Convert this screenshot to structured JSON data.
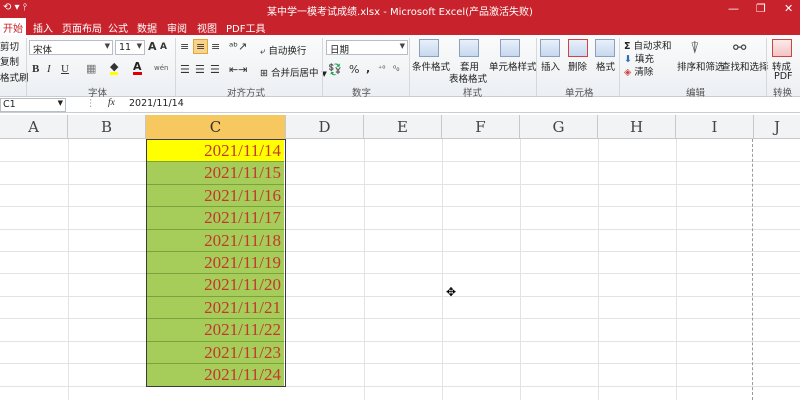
{
  "window": {
    "title": "某中学一模考试成绩.xlsx - Microsoft Excel(产品激活失败)",
    "quick_access": "⟲ ▾ ⫯",
    "controls": [
      "—",
      "❐",
      "✕"
    ]
  },
  "menu": {
    "tabs": [
      "开始",
      "插入",
      "页面布局",
      "公式",
      "数据",
      "审阅",
      "视图",
      "PDF工具"
    ],
    "active": "开始"
  },
  "ribbon": {
    "clipboard": {
      "cut": "剪切",
      "copy": "复制",
      "format_painter": "格式刷"
    },
    "font": {
      "name": "宋体",
      "size": "11",
      "grow": "A",
      "shrink": "A",
      "bold": "B",
      "italic": "I",
      "underline": "U",
      "font_color": "A",
      "wen": "wén",
      "group_label": "字体"
    },
    "alignment": {
      "wrap": "自动换行",
      "merge": "合并后居中",
      "group_label": "对齐方式"
    },
    "number": {
      "format": "日期",
      "percent": "%",
      "comma": ",",
      "group_label": "数字"
    },
    "styles": {
      "conditional": "条件格式",
      "table_l1": "套用",
      "table_l2": "表格格式",
      "cell_styles": "单元格样式",
      "group_label": "样式"
    },
    "cells": {
      "insert": "插入",
      "delete": "删除",
      "format": "格式",
      "group_label": "单元格"
    },
    "editing": {
      "autosum": "自动求和",
      "fill": "填充",
      "clear": "清除",
      "sort_filter": "排序和筛选",
      "find_select": "查找和选择",
      "group_label": "编辑"
    },
    "convert": {
      "l1": "转成",
      "l2": "PDF",
      "group_label": "转换"
    }
  },
  "formula_bar": {
    "name_box": "C1",
    "fx": "fx",
    "value": "2021/11/14"
  },
  "columns": [
    "A",
    "B",
    "C",
    "D",
    "E",
    "F",
    "G",
    "H",
    "I",
    "J"
  ],
  "selected_column": "C",
  "cells_c": [
    "2021/11/14",
    "2021/11/15",
    "2021/11/16",
    "2021/11/17",
    "2021/11/18",
    "2021/11/19",
    "2021/11/20",
    "2021/11/21",
    "2021/11/22",
    "2021/11/23",
    "2021/11/24"
  ],
  "colors": {
    "accent": "#c8232c",
    "first_cell_fill": "#ffff00",
    "range_fill": "#a6cc5a",
    "date_text": "#c0392b",
    "selected_header": "#f6c85f"
  }
}
